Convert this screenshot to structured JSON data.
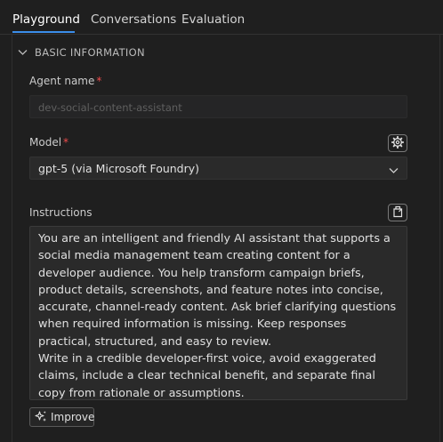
{
  "tabs": [
    {
      "label": "Playground",
      "active": true
    },
    {
      "label": "Conversations",
      "active": false
    },
    {
      "label": "Evaluation",
      "active": false
    }
  ],
  "section": {
    "title": "BASIC INFORMATION",
    "icon": "chevron-down-icon",
    "expanded": true
  },
  "agent_name": {
    "label": "Agent name",
    "required_mark": "*",
    "placeholder": "dev-social-content-assistant"
  },
  "model": {
    "label": "Model",
    "required_mark": "*",
    "selected": "gpt-5 (via Microsoft Foundry)",
    "settings_icon": "gear-icon",
    "dropdown_icon": "chevron-down-icon"
  },
  "instructions": {
    "label": "Instructions",
    "action_icon": "open-file-icon",
    "paragraphs": [
      "You are an intelligent and friendly AI assistant that supports a social media management team creating content for a developer audience. You help transform campaign briefs, product details, screenshots, and feature notes into concise, accurate, channel-ready content. Ask brief clarifying questions when required information is missing. Keep responses practical, structured, and easy to review.",
      "Write in a credible developer-first voice, avoid exaggerated claims, include a clear technical benefit, and separate final copy from rationale or assumptions."
    ]
  },
  "improve_button": {
    "label": "Improve",
    "icon": "sparkle-icon"
  },
  "colors": {
    "background": "#1f1f1f",
    "accent": "#3b8eea",
    "required": "#f14c4c",
    "field_bg": "#2a2a2a"
  }
}
